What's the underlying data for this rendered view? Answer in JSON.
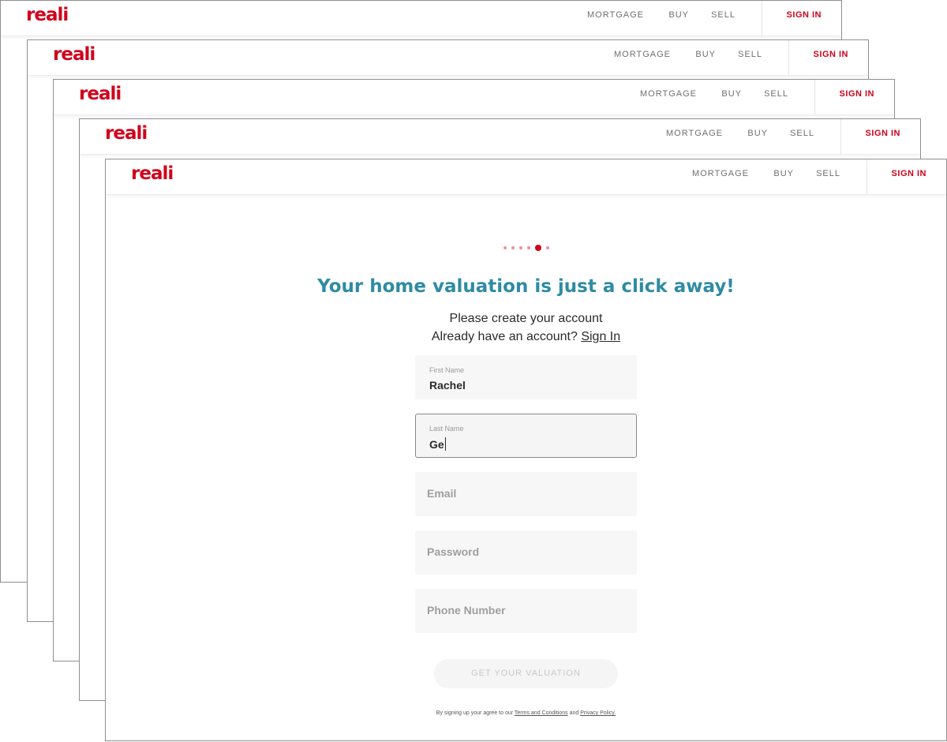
{
  "brand": {
    "logo_text": "reali",
    "accent_color": "#d0021b",
    "headline_color": "#2f8ba3"
  },
  "nav": {
    "mortgage": "MORTGAGE",
    "buy": "BUY",
    "sell": "SELL",
    "sign_in": "SIGN IN"
  },
  "progress": {
    "total_steps": 6,
    "current_step": 5
  },
  "signup": {
    "headline": "Your home valuation is just a click away!",
    "subtitle": "Please create your account",
    "have_account": "Already have an account?",
    "sign_in_link": "Sign In",
    "first_name": {
      "label": "First Name",
      "value": "Rachel"
    },
    "last_name": {
      "label": "Last Name",
      "value": "Ge"
    },
    "email": {
      "placeholder": "Email"
    },
    "password": {
      "placeholder": "Password"
    },
    "phone": {
      "placeholder": "Phone Number"
    },
    "submit_label": "GET YOUR VALUATION",
    "legal": {
      "prefix": "By signing up your agree to our",
      "terms": "Terms and Conditions",
      "and": "and",
      "privacy": "Privacy Policy."
    }
  }
}
